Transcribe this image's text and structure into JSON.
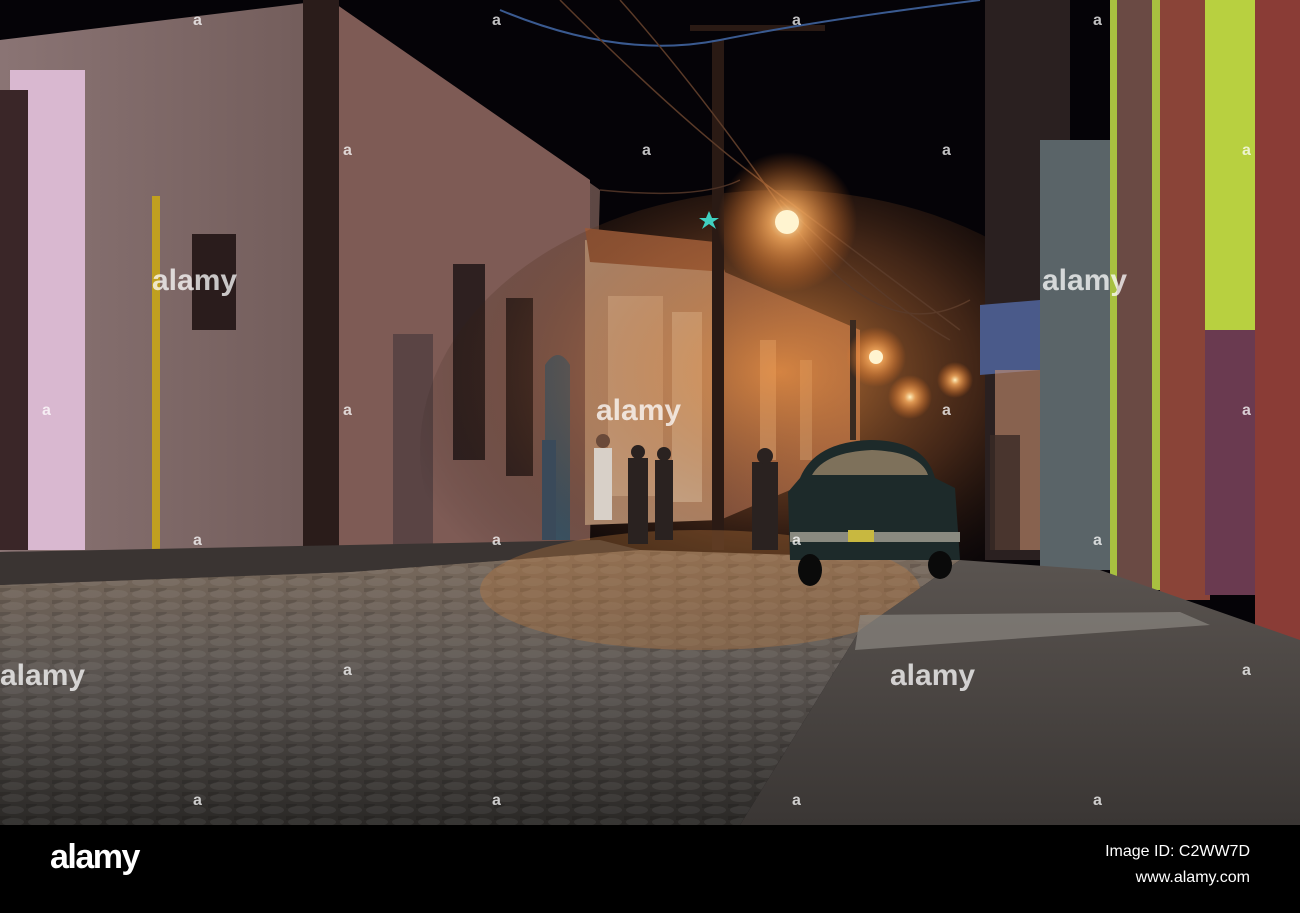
{
  "photo": {
    "subject": "night street",
    "watermark_text": "alamy",
    "watermark_mark": "a"
  },
  "footer": {
    "logo": "alamy",
    "image_id": "Image ID: C2WW7D",
    "site": "www.alamy.com"
  },
  "colors": {
    "sky": "#050307",
    "lamp": "#ffb060",
    "cobbles": "#5a5048",
    "car": "#1d2a2a",
    "wall_left": "#6b5552",
    "wall_right_yellow": "#a8c040"
  },
  "icons": [
    "street-lamp-icon",
    "star-light-icon"
  ]
}
